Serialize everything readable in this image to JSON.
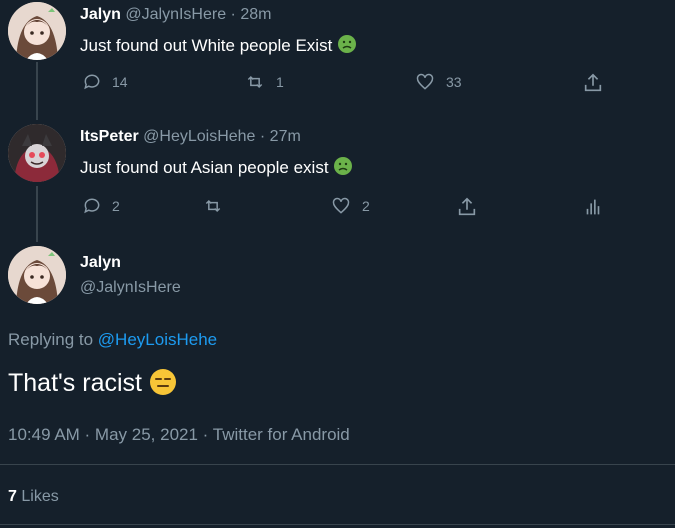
{
  "tweet1": {
    "name": "Jalyn",
    "handle": "@JalynIsHere",
    "time": "· 28m",
    "text": "Just found out White people Exist",
    "emoji": "nauseated-face-icon",
    "replies": "14",
    "retweets": "1",
    "likes": "33"
  },
  "tweet2": {
    "name": "ItsPeter",
    "handle": "@HeyLoisHehe",
    "time": "· 27m",
    "text": "Just found out Asian people exist",
    "emoji": "nauseated-face-icon",
    "replies": "2",
    "retweets": "",
    "likes": "2"
  },
  "main": {
    "name": "Jalyn",
    "handle": "@JalynIsHere",
    "replying_prefix": "Replying to",
    "replying_handle": "@HeyLoisHehe",
    "text": "That's racist",
    "emoji": "expressionless-face-icon",
    "meta": "10:49 AM · May 25, 2021 · Twitter for Android",
    "likes_count": "7",
    "likes_label": "Likes"
  },
  "colors": {
    "background": "#15202b",
    "muted": "#8899a6",
    "link": "#1d9bf0",
    "divider": "#38444d",
    "nausea_emoji": "#6bb24a",
    "neutral_emoji": "#f7c537"
  }
}
